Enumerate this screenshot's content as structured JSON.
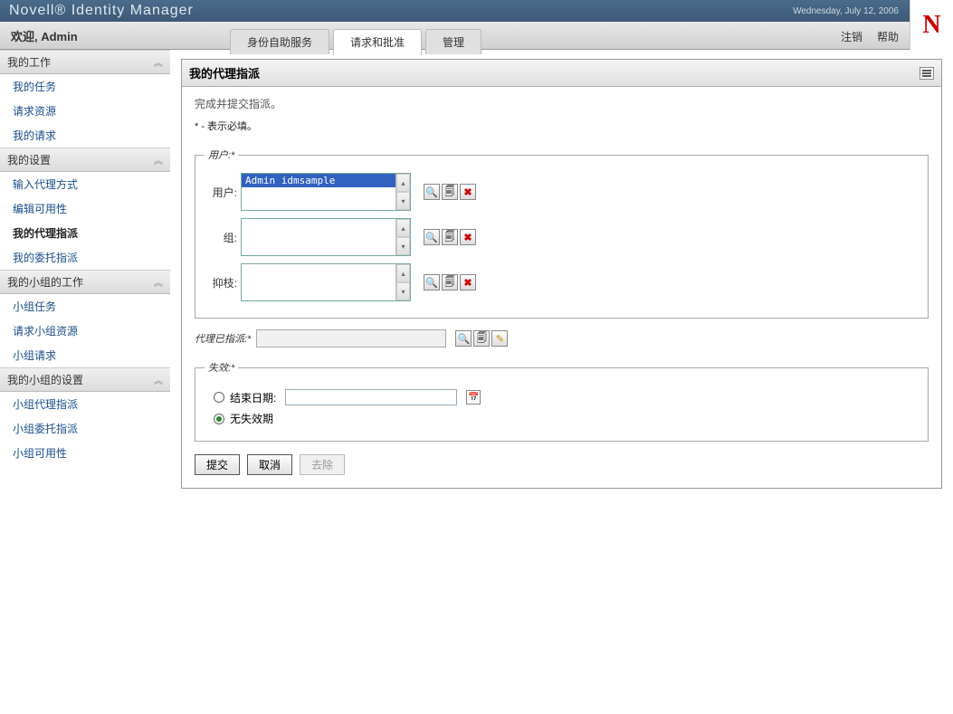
{
  "header": {
    "app_title": "Novell® Identity Manager",
    "date_text": "Wednesday, July 12, 2006",
    "logo_letter": "N"
  },
  "welcome": {
    "text": "欢迎, Admin"
  },
  "tabs": {
    "items": [
      {
        "label": "身份自助服务",
        "active": false
      },
      {
        "label": "请求和批准",
        "active": true
      },
      {
        "label": "管理",
        "active": false
      }
    ]
  },
  "top_links": {
    "logout": "注销",
    "help": "帮助"
  },
  "sidebar": {
    "sections": [
      {
        "title": "我的工作",
        "items": [
          {
            "label": "我的任务",
            "current": false
          },
          {
            "label": "请求资源",
            "current": false
          },
          {
            "label": "我的请求",
            "current": false
          }
        ]
      },
      {
        "title": "我的设置",
        "items": [
          {
            "label": "输入代理方式",
            "current": false
          },
          {
            "label": "编辑可用性",
            "current": false
          },
          {
            "label": "我的代理指派",
            "current": true
          },
          {
            "label": "我的委托指派",
            "current": false
          }
        ]
      },
      {
        "title": "我的小组的工作",
        "items": [
          {
            "label": "小组任务",
            "current": false
          },
          {
            "label": "请求小组资源",
            "current": false
          },
          {
            "label": "小组请求",
            "current": false
          }
        ]
      },
      {
        "title": "我的小组的设置",
        "items": [
          {
            "label": "小组代理指派",
            "current": false
          },
          {
            "label": "小组委托指派",
            "current": false
          },
          {
            "label": "小组可用性",
            "current": false
          }
        ]
      }
    ]
  },
  "panel": {
    "title": "我的代理指派",
    "intro": "完成并提交指派。",
    "required_note": "* - 表示必填。"
  },
  "user_fieldset": {
    "legend": "用户:*",
    "rows": {
      "user": {
        "label": "用户:",
        "selected": "Admin idmsample"
      },
      "group": {
        "label": "组:"
      },
      "container": {
        "label": "抑枝:"
      }
    }
  },
  "assigned": {
    "label": "代理已指派:*"
  },
  "expiry": {
    "legend": "失效:*",
    "end_date_label": "结束日期:",
    "no_expiry_label": "无失效期"
  },
  "buttons": {
    "submit": "提交",
    "cancel": "取消",
    "remove": "去除"
  }
}
